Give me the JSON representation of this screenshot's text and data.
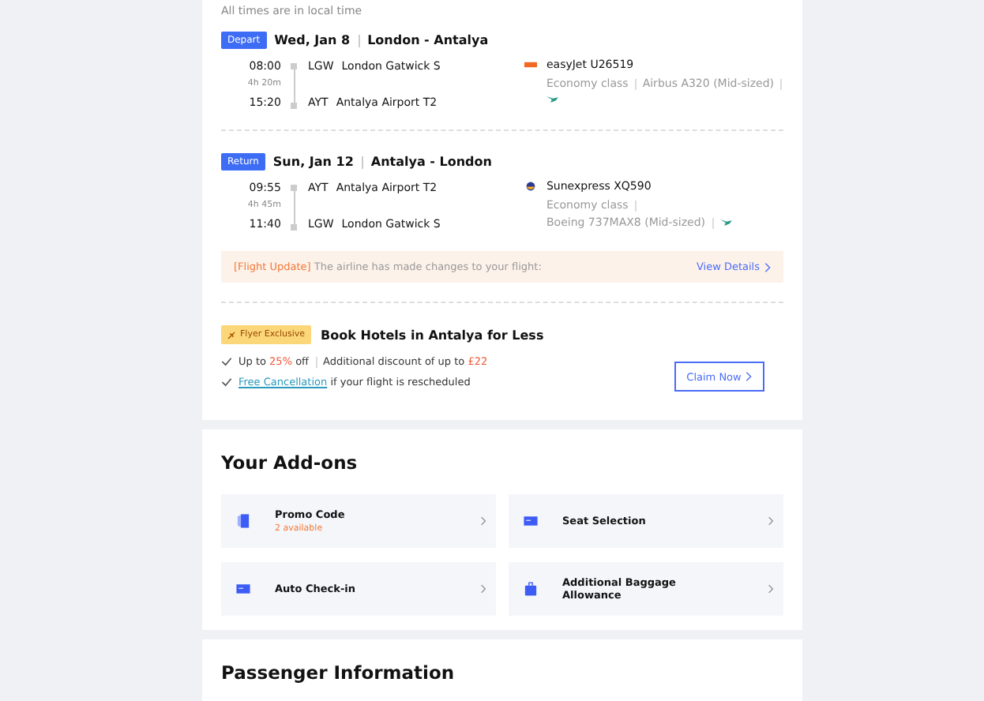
{
  "note": "All times are in local time",
  "flights": [
    {
      "tag": "Depart",
      "date": "Wed, Jan 8",
      "route": "London - Antalya",
      "dep_time": "08:00",
      "duration": "4h 20m",
      "arr_time": "15:20",
      "dep_code": "LGW",
      "dep_airport": "London Gatwick S",
      "arr_code": "AYT",
      "arr_airport": "Antalya Airport T2",
      "airline": "easyJet U26519",
      "kind": "stripe",
      "details": [
        "Economy class",
        "Airbus A320 (Mid-sized)"
      ]
    },
    {
      "tag": "Return",
      "date": "Sun, Jan 12",
      "route": "Antalya - London",
      "dep_time": "09:55",
      "duration": "4h 45m",
      "arr_time": "11:40",
      "dep_code": "AYT",
      "dep_airport": "Antalya Airport T2",
      "arr_code": "LGW",
      "arr_airport": "London Gatwick S",
      "airline": "Sunexpress XQ590",
      "kind": "disc",
      "details": [
        "Economy class",
        "Boeing 737MAX8 (Mid-sized)"
      ]
    }
  ],
  "update": {
    "label": "[Flight Update]",
    "text": "The airline has made changes to your flight:",
    "link": "View Details"
  },
  "promo": {
    "badge": "Flyer Exclusive",
    "title": "Book Hotels in Antalya for Less",
    "line1_pre": "Up to ",
    "line1_highlight": "25%",
    "line1_post": " off",
    "line1_extra_pre": "Additional discount of up to ",
    "line1_extra_highlight": "£22",
    "link": "Free Cancellation",
    "line2": " if your flight is rescheduled",
    "button": "Claim Now"
  },
  "addons": {
    "title": "Your Add-ons",
    "items": [
      {
        "kind": "ticket",
        "label": "Promo Code",
        "sub": "2 available"
      },
      {
        "kind": "seat",
        "label": "Seat Selection"
      },
      {
        "kind": "screen",
        "label": "Auto Check-in"
      },
      {
        "kind": "bag",
        "label": "Additional Baggage Allowance"
      }
    ]
  },
  "passenger": {
    "title": "Passenger Information"
  }
}
